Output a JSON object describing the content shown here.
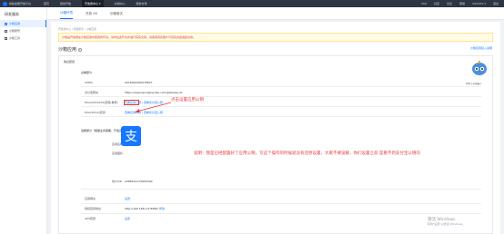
{
  "topbar": {
    "logo_text": "蚂蚁金服开放平台",
    "nav": [
      "首页",
      "我的开放",
      "开发者中心 ▾",
      "文档中心",
      "服务市场"
    ],
    "right": [
      "FAQ",
      "社区",
      "论坛",
      "帮助",
      "XXXXXX ▾",
      "退出"
    ]
  },
  "sidebar": {
    "title": "研发服务",
    "items": [
      "沙箱应用",
      "沙箱账号",
      "沙箱工具"
    ]
  },
  "subnav": {
    "tabs": [
      "沙箱环境",
      "开放 V6",
      "沙箱测试"
    ]
  },
  "breadcrumb": "开发者中心 / 研发服务 / 沙箱应用",
  "alert": "沙箱是开发者在沙箱应用中使用的环境，请勿在此环境中进行真实交易，请使用真实账户与真实资金发起交易。",
  "alert_link": "沙箱应用接入说明",
  "app_title": "沙箱应用",
  "help_glyph": "?",
  "panel": {
    "heading": "信息配置",
    "section1": "必看部分",
    "rows": [
      {
        "label": "APPID",
        "value": "2016092300578627",
        "link": ""
      },
      {
        "label": "支付宝网关",
        "value": "https://openapi.alipaydev.com/gateway.do",
        "link": ""
      },
      {
        "label": "RSA2(SHA256)密钥(推荐)",
        "value": "",
        "link": "查看应用公钥 | 查看支付宝公钥"
      },
      {
        "label": "RSA(SHA1)密钥",
        "value": "",
        "link": "查看应用公钥 | 查看支付宝公钥"
      }
    ],
    "section2": "选看部分（根据业务需要，开发完选看）",
    "app_info": {
      "name_label": "应用名称",
      "name": "沙箱应用名称",
      "icon_label": "应用图标",
      "merchant_label": "商户PID",
      "merchant": "2088102175650390"
    },
    "section3_rows": [
      {
        "label": "应用网关",
        "value": "设置"
      },
      {
        "label": "授权回调地址",
        "value": "http://192.168.1.6:8080/"
      },
      {
        "label": "AES密钥",
        "value": "设置"
      }
    ],
    "edit_link": "修改"
  },
  "annotations": {
    "note1": "点击设置应用公钥",
    "note2": "说明：我是已经配置好了应用公钥，写这个操作的时候就没有还原设置，大家不要误解，你们设置之前 是看不到支付宝公钥的"
  },
  "mascot_label": "阿里小宝机器人",
  "alipay_glyph": "支",
  "watermark": {
    "line1": "激活 Windows",
    "line2": "转到\"设置\"以激活 Windows。"
  },
  "colors": {
    "accent": "#1677ff",
    "annotation": "#e4393c",
    "topbar": "#2f3541"
  }
}
